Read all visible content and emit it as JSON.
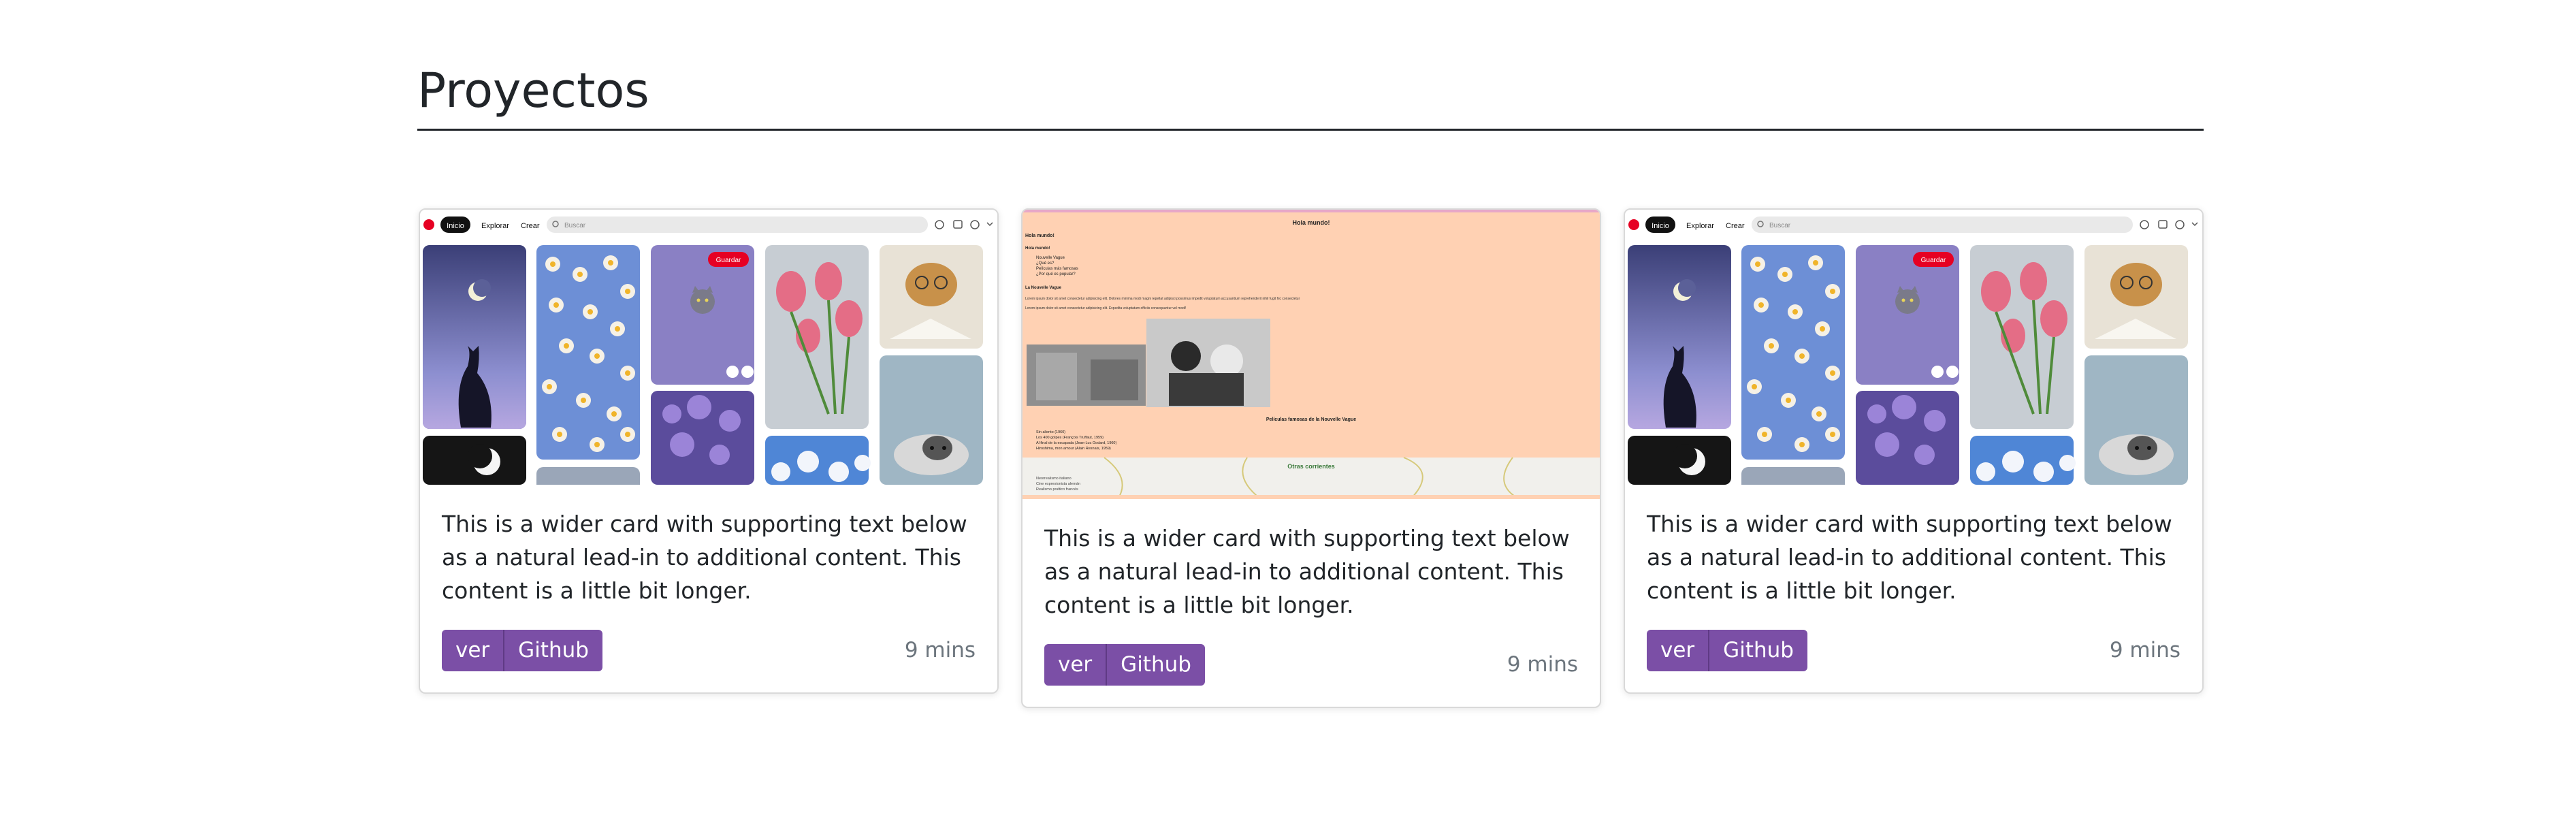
{
  "section": {
    "title": "Proyectos"
  },
  "pinterest_mock": {
    "nav": {
      "home": "Inicio",
      "explore": "Explorar",
      "create": "Crear",
      "search_placeholder": "Buscar"
    },
    "save_badge": "Guardar"
  },
  "web_mock": {
    "heading": "Hola mundo!",
    "line1": "Hola mundo!",
    "line2": "Hola mundo!",
    "bullets": [
      "Nouvelle Vague",
      "¿Qué es?",
      "Películas más famosas",
      "¿Por qué es popular?"
    ],
    "subheading": "La Nouvelle Vague",
    "paragraph1": "Lorem ipsum dolor sit amet consectetur adipisicing elit. Dolores minima modi magni repellat adipisci possimus impedit voluptatum accusantium reprehenderit nihil fugit hic consectetur",
    "paragraph2": "Lorem ipsum dolor sit amet consectetur adipisicing elit. Expedita voluptatum officiis consequuntur vel modi!",
    "films_title": "Películas famosas de la Nouvelle Vague",
    "films": [
      "Sin aliento (1960)",
      "Los 400 golpes (François Truffaut, 1959)",
      "Al final de la escapada (Jean-Luc Godard, 1960)",
      "Hiroshima, mon amour (Alain Resnais, 1959)"
    ],
    "other_title": "Otras corrientes",
    "other_items": [
      "Neorrealismo italiano",
      "Cine expresionista alemán",
      "Realismo poético francés"
    ]
  },
  "cards": [
    {
      "text": "This is a wider card with supporting text below as a natural lead-in to additional content. This content is a little bit longer.",
      "btn_view": "ver",
      "btn_github": "Github",
      "time": "9 mins"
    },
    {
      "text": "This is a wider card with supporting text below as a natural lead-in to additional content. This content is a little bit longer.",
      "btn_view": "ver",
      "btn_github": "Github",
      "time": "9 mins"
    },
    {
      "text": "This is a wider card with supporting text below as a natural lead-in to additional content. This content is a little bit longer.",
      "btn_view": "ver",
      "btn_github": "Github",
      "time": "9 mins"
    }
  ],
  "colors": {
    "button": "#7b4fa6",
    "pinterest_red": "#e60023",
    "web_bg": "#ffd1b3"
  }
}
